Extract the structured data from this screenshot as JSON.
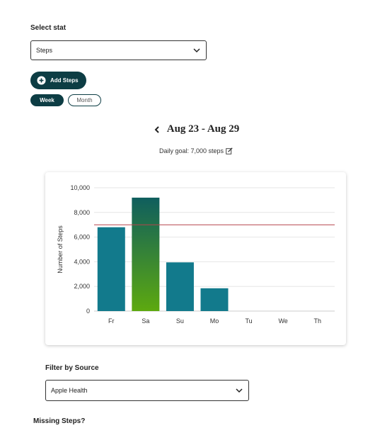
{
  "select_stat": {
    "label": "Select stat",
    "value": "Steps"
  },
  "add_button": {
    "label": "Add Steps"
  },
  "period_toggle": {
    "week": "Week",
    "month": "Month",
    "selected": "Week"
  },
  "date_range": {
    "title": "Aug 23 - Aug 29"
  },
  "goal": {
    "text": "Daily goal: 7,000 steps"
  },
  "chart_data": {
    "type": "bar",
    "categories": [
      "Fr",
      "Sa",
      "Su",
      "Mo",
      "Tu",
      "We",
      "Th"
    ],
    "values": [
      6800,
      9200,
      3950,
      1850,
      0,
      0,
      0
    ],
    "ylabel": "Number of Steps",
    "ylim": [
      0,
      10000
    ],
    "yticks": [
      0,
      2000,
      4000,
      6000,
      8000,
      10000
    ],
    "ytick_labels": [
      "0",
      "2,000",
      "4,000",
      "6,000",
      "8,000",
      "10,000"
    ],
    "goal_line": 7000,
    "colors": {
      "bar": "#127a8c",
      "bar_over_goal_top": "#0f5e5e",
      "bar_over_goal_bottom": "#5da90f",
      "goal_line": "#b5444a",
      "grid": "#e6e6e6"
    },
    "grid": true
  },
  "filter": {
    "label": "Filter by Source",
    "value": "Apple Health"
  },
  "missing": {
    "label": "Missing Steps?"
  }
}
